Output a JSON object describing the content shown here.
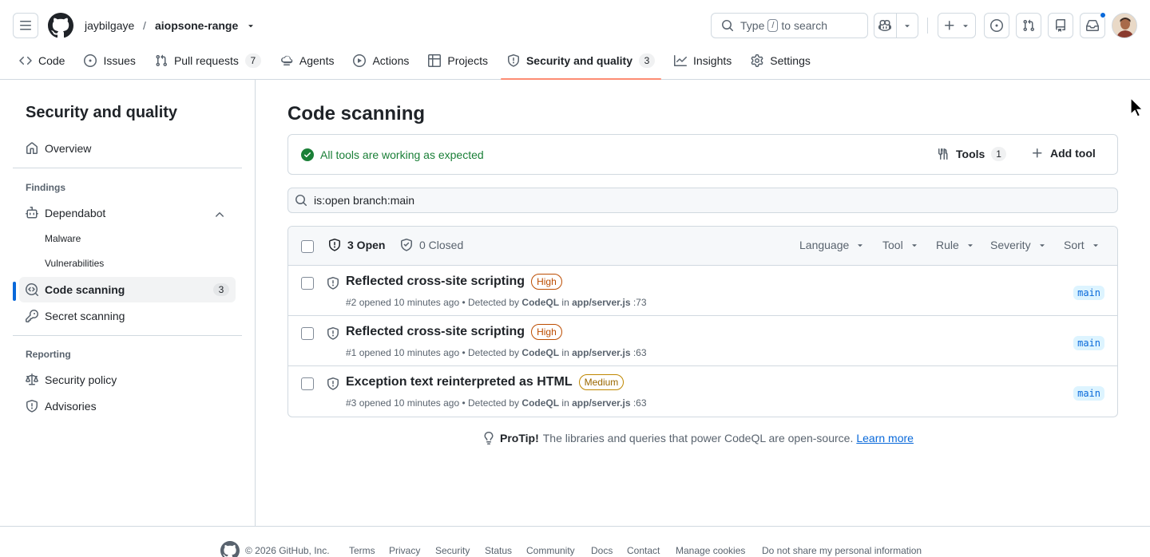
{
  "header": {
    "owner": "jaybilgaye",
    "separator": "/",
    "repo": "aiopsone-range",
    "search": {
      "prefix": "Type",
      "key": "/",
      "suffix": "to search"
    }
  },
  "tabs": [
    {
      "label": "Code",
      "icon": "code-icon"
    },
    {
      "label": "Issues",
      "icon": "issue-icon"
    },
    {
      "label": "Pull requests",
      "icon": "pull-request-icon",
      "count": "7"
    },
    {
      "label": "Agents",
      "icon": "agents-icon"
    },
    {
      "label": "Actions",
      "icon": "play-icon"
    },
    {
      "label": "Projects",
      "icon": "table-icon"
    },
    {
      "label": "Security and quality",
      "icon": "shield-icon",
      "count": "3",
      "active": true
    },
    {
      "label": "Insights",
      "icon": "graph-icon"
    },
    {
      "label": "Settings",
      "icon": "gear-icon"
    }
  ],
  "sidebar": {
    "title": "Security and quality",
    "overview": "Overview",
    "findings_heading": "Findings",
    "dependabot": "Dependabot",
    "malware": "Malware",
    "vulnerabilities": "Vulnerabilities",
    "code_scanning": "Code scanning",
    "code_scanning_count": "3",
    "secret_scanning": "Secret scanning",
    "reporting_heading": "Reporting",
    "security_policy": "Security policy",
    "advisories": "Advisories"
  },
  "main": {
    "title": "Code scanning",
    "status_text": "All tools are working as expected",
    "tools_label": "Tools",
    "tools_count": "1",
    "add_tool_label": "Add tool",
    "filter_query": "is:open branch:main",
    "open_label": "3 Open",
    "closed_label": "0 Closed",
    "filters": [
      "Language",
      "Tool",
      "Rule",
      "Severity",
      "Sort"
    ],
    "alerts": [
      {
        "title": "Reflected cross-site scripting",
        "severity": "High",
        "number": "#2",
        "opened": "opened 10 minutes ago",
        "detected": "• Detected by",
        "tool": "CodeQL",
        "in": "in",
        "file": "app/server.js",
        "line": ":73",
        "branch": "main"
      },
      {
        "title": "Reflected cross-site scripting",
        "severity": "High",
        "number": "#1",
        "opened": "opened 10 minutes ago",
        "detected": "• Detected by",
        "tool": "CodeQL",
        "in": "in",
        "file": "app/server.js",
        "line": ":63",
        "branch": "main"
      },
      {
        "title": "Exception text reinterpreted as HTML",
        "severity": "Medium",
        "number": "#3",
        "opened": "opened 10 minutes ago",
        "detected": "• Detected by",
        "tool": "CodeQL",
        "in": "in",
        "file": "app/server.js",
        "line": ":63",
        "branch": "main"
      }
    ],
    "protip_label": "ProTip!",
    "protip_text": "The libraries and queries that power CodeQL are open-source.",
    "protip_link": "Learn more"
  },
  "footer": {
    "copyright": "© 2026 GitHub, Inc.",
    "links": [
      "Terms",
      "Privacy",
      "Security",
      "Status",
      "Community",
      "Docs",
      "Contact",
      "Manage cookies",
      "Do not share my personal information"
    ]
  },
  "colors": {
    "accent": "#0969da",
    "success": "#1a7f37",
    "severity_high": "#bc4c00",
    "severity_medium": "#9a6700",
    "active_tab_underline": "#fd8c73"
  }
}
